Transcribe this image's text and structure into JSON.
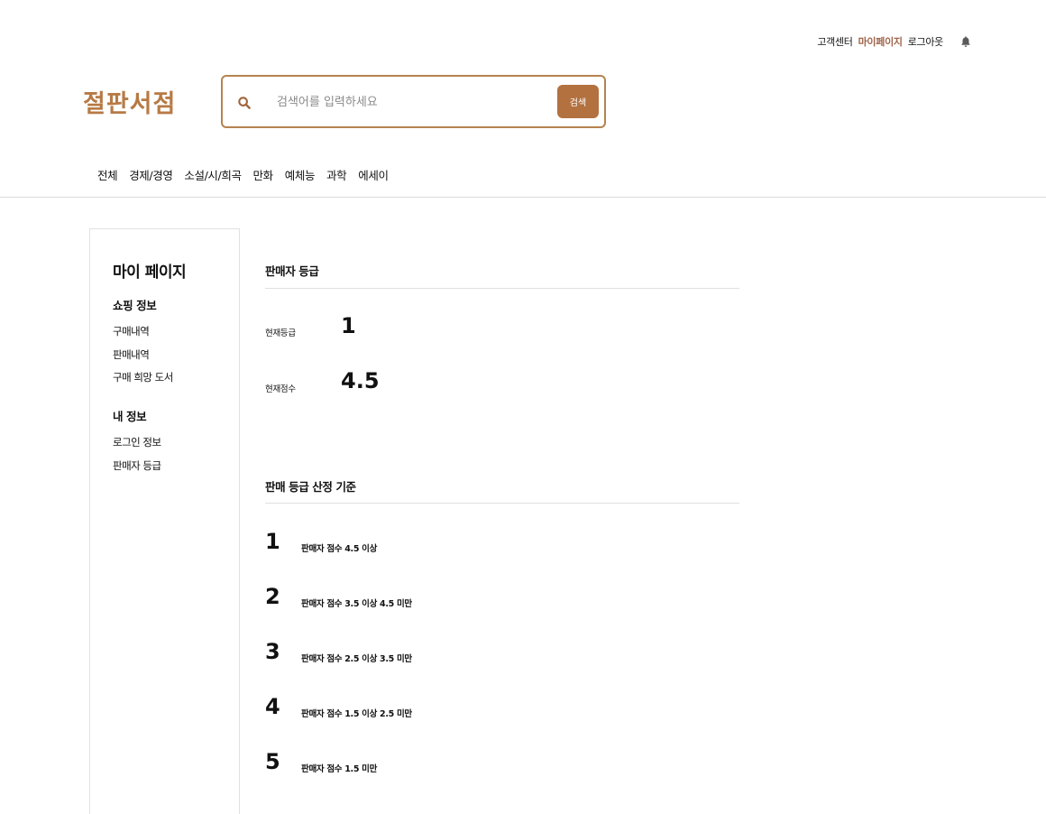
{
  "header": {
    "links": {
      "customer_center": "고객센터",
      "mypage": "마이페이지",
      "logout": "로그아웃"
    },
    "icons": {
      "notification": "bell-icon",
      "search": "search-icon"
    },
    "logo": "절판서점",
    "search": {
      "placeholder": "검색어를 입력하세요",
      "button_label": "검색"
    }
  },
  "categories": [
    "전체",
    "경제/경영",
    "소설/시/희곡",
    "만화",
    "예체능",
    "과학",
    "에세이"
  ],
  "sidebar": {
    "title": "마이 페이지",
    "shopping_section": {
      "title": "쇼핑 정보",
      "items": [
        "구매내역",
        "판매내역",
        "구매 희망 도서"
      ]
    },
    "my_info_section": {
      "title": "내 정보",
      "items": [
        "로그인 정보",
        "판매자 등급"
      ]
    }
  },
  "seller_grade": {
    "title": "판매자 등급",
    "current_grade_label": "현재등급",
    "current_grade_value": "1",
    "current_score_label": "현재점수",
    "current_score_value": "4.5"
  },
  "criteria": {
    "title": "판매 등급 산정 기준",
    "items": [
      {
        "grade": "1",
        "text": "판매자 점수 4.5 이상"
      },
      {
        "grade": "2",
        "text": "판매자 점수 3.5 이상 4.5 미만"
      },
      {
        "grade": "3",
        "text": "판매자 점수 2.5 이상 3.5 미만"
      },
      {
        "grade": "4",
        "text": "판매자 점수 1.5 이상 2.5 미만"
      },
      {
        "grade": "5",
        "text": "판매자 점수 1.5 미만"
      }
    ]
  },
  "colors": {
    "accent": "#b3713f",
    "logo": "#b77a45",
    "mypage_link": "#a0644a"
  }
}
